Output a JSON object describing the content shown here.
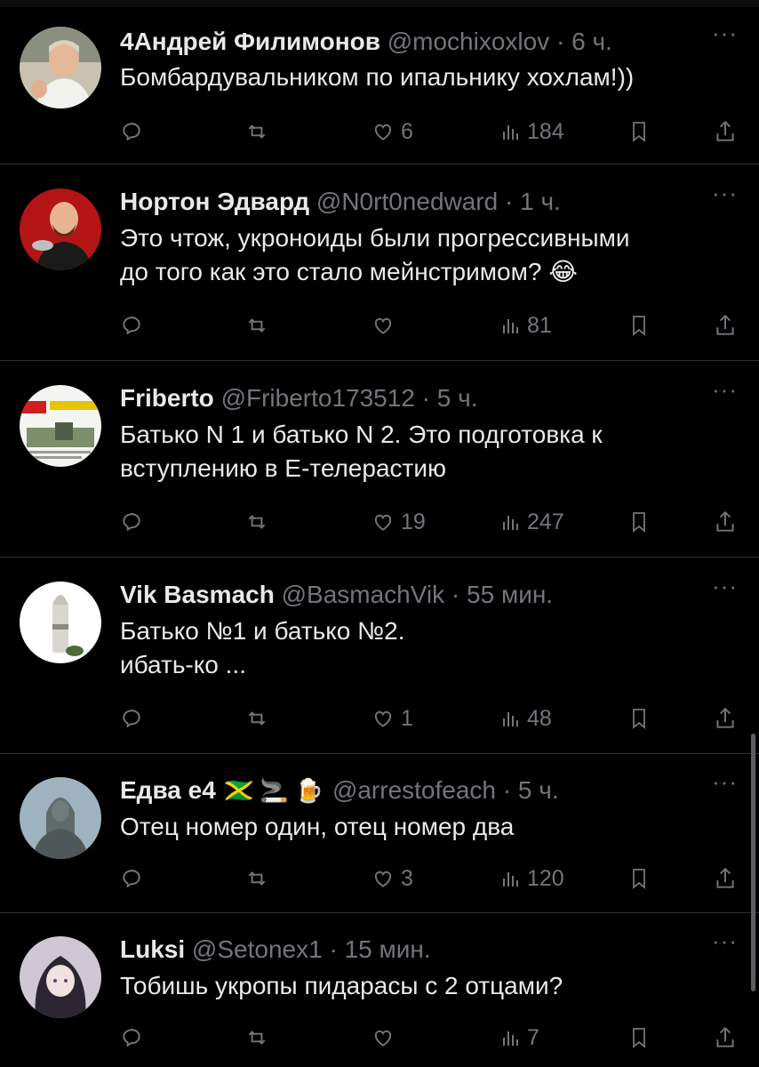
{
  "replies": [
    {
      "name": "4Андрей Филимонов",
      "handle": "@mochixoxlov",
      "time": "6 ч.",
      "text": "Бомбардувальником по ипальнику хохлам!))",
      "likes": "6",
      "views": "184",
      "avatar_icon": "man-avatar"
    },
    {
      "name": "Нортон Эдвард",
      "handle": "@N0rt0nedward",
      "time": "1 ч.",
      "text": "Это чтож, укроноиды были прогрессивными\nдо того как это стало мейнстримом? 😂",
      "likes": "",
      "views": "81",
      "avatar_icon": "lenin-avatar"
    },
    {
      "name": "Friberto",
      "handle": "@Friberto173512",
      "time": "5 ч.",
      "text": "Батько N 1 и батько N 2. Это подготовка к\nвступлению в Е-телерастию",
      "likes": "19",
      "views": "247",
      "avatar_icon": "newspaper-avatar"
    },
    {
      "name": "Vik Basmach",
      "handle": "@BasmachVik",
      "time": "55 мин.",
      "text": "Батько №1 и батько №2.\nибать-ко ...",
      "likes": "1",
      "views": "48",
      "avatar_icon": "shell-avatar"
    },
    {
      "name": "Едва е4",
      "name_emoji": "🇯🇲 🚬 🍺",
      "handle": "@arrestofeach",
      "time": "5 ч.",
      "text": "Отец номер один, отец номер два",
      "likes": "3",
      "views": "120",
      "avatar_icon": "monument-avatar"
    },
    {
      "name": "Luksi",
      "handle": "@Setonex1",
      "time": "15 мин.",
      "text": "Тобишь укропы пидарасы с 2 отцами?",
      "likes": "",
      "views": "7",
      "avatar_icon": "anime-avatar"
    }
  ],
  "ui": {
    "separator": "·",
    "more": "···",
    "icons": [
      "reply-icon",
      "retweet-icon",
      "like-icon",
      "views-icon",
      "bookmark-icon",
      "share-icon"
    ]
  }
}
